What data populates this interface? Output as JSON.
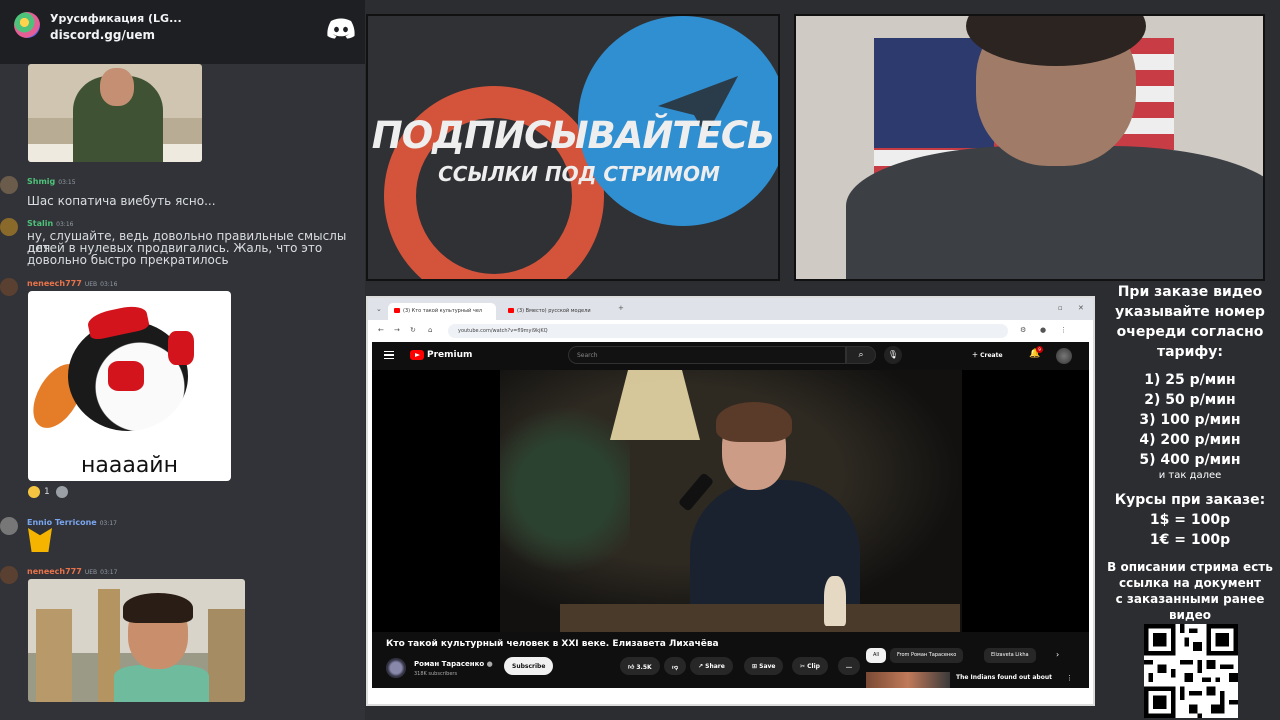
{
  "discord": {
    "server_name": "Урусификация (LG...",
    "invite": "discord.gg/uem",
    "messages": [
      {
        "author": "Shmig",
        "time": "03:15",
        "text": "Шас копатича виебуть ясно...",
        "name_color": "#4ec27a"
      },
      {
        "author": "Stalin",
        "time": "03:16",
        "text_lines": [
          "ну, слушайте, ведь довольно правильные смыслы для",
          "детей в нулевых продвигались. Жаль, что это",
          "довольно быстро прекратилось"
        ],
        "name_color": "#4ec27a"
      },
      {
        "author": "neneech777",
        "badge": "UEB",
        "time": "03:16",
        "image_caption": "наааайн",
        "name_color": "#e8734a"
      },
      {
        "author": "Ennio Terricone",
        "time": "03:17",
        "name_color": "#7aa6f0"
      },
      {
        "author": "neneech777",
        "badge": "UEB",
        "time": "03:17",
        "name_color": "#e8734a"
      }
    ],
    "reactions": [
      {
        "count": "1"
      },
      {
        "count": ""
      }
    ]
  },
  "promo": {
    "title": "ПОДПИСЫВАЙТЕСЬ",
    "subtitle": "ССЫЛКИ ПОД СТРИМОМ"
  },
  "browser": {
    "tabs": [
      "(3) Кто такой культурный чел",
      "(3) Вместо) русской модели"
    ],
    "url": "youtube.com/watch?v=fl9myi9kjKQ"
  },
  "youtube": {
    "brand": "Premium",
    "search_placeholder": "Search",
    "create_label": "Create",
    "notifications": "9",
    "video_title": "Кто такой культурный человек в XXI веке. Елизавета Лихачёва",
    "channel_name": "Роман Тарасенко",
    "channel_subs": "318K subscribers",
    "subscribe_label": "Subscribe",
    "likes": "3.5K",
    "share_label": "Share",
    "save_label": "Save",
    "clip_label": "Clip",
    "more_label": "…",
    "chips": [
      "All",
      "From Роман Тарасенко",
      "Elizaveta Likha"
    ],
    "rec_title": "The Indians found out about"
  },
  "info": {
    "order_lines": [
      "При заказе видео",
      "указывайте номер",
      "очереди согласно",
      "тарифу:"
    ],
    "tariffs": [
      "1) 25 р/мин",
      "2) 50 р/мин",
      "3) 100 р/мин",
      "4) 200 р/мин",
      "5) 400 р/мин"
    ],
    "etc": "и так далее",
    "rates_title": "Курсы при заказе:",
    "rates": [
      "1$ = 100р",
      "1€ = 100р"
    ],
    "doc_lines": [
      "В описании стрима есть",
      "ссылка на документ",
      "с заказанными ранее",
      "видео"
    ]
  },
  "colors": {
    "discord_bg": "#313338",
    "youtube_red": "#ff0000",
    "promo_red": "#d4543b",
    "promo_blue": "#2f8fd0"
  }
}
